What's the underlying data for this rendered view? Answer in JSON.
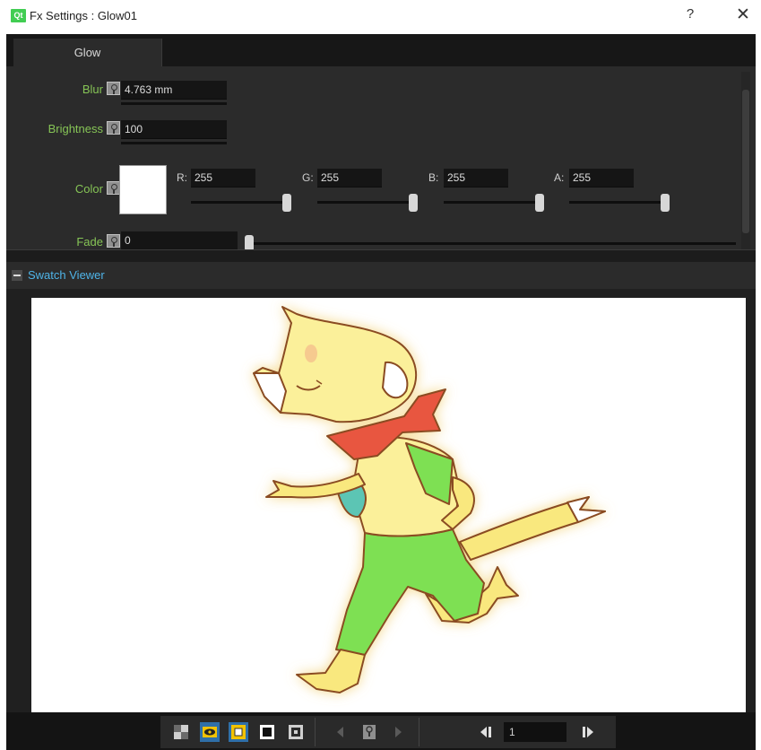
{
  "window": {
    "title": "Fx Settings : Glow01",
    "logo_text": "Qt",
    "help_label": "?",
    "close_label": "✕"
  },
  "tabs": [
    {
      "label": "Glow",
      "active": true
    }
  ],
  "params": {
    "blur": {
      "label": "Blur",
      "value": "4.763 mm"
    },
    "brightness": {
      "label": "Brightness",
      "value": "100"
    },
    "color": {
      "label": "Color",
      "swatch": "#ffffff",
      "channels": [
        {
          "label": "R:",
          "value": "255",
          "level": 1.0
        },
        {
          "label": "G:",
          "value": "255",
          "level": 1.0
        },
        {
          "label": "B:",
          "value": "255",
          "level": 1.0
        },
        {
          "label": "A:",
          "value": "255",
          "level": 1.0
        }
      ]
    },
    "fade": {
      "label": "Fade",
      "value": "0",
      "level": 0.0
    }
  },
  "swatch_viewer": {
    "title": "Swatch Viewer",
    "collapse_label": "−"
  },
  "toolbar": {
    "frame_value": "1",
    "buttons": [
      "checkerboard-bg-icon",
      "eye-preview-icon",
      "white-bg-icon",
      "black-bg-icon",
      "snapshot-icon",
      "prev-key-icon",
      "key-icon",
      "next-key-icon",
      "prev-frame-icon",
      "next-frame-icon"
    ]
  },
  "colors": {
    "accent_label": "#86c456",
    "swatch_title": "#4fb4e8",
    "toggle_active": "#f2c200"
  }
}
